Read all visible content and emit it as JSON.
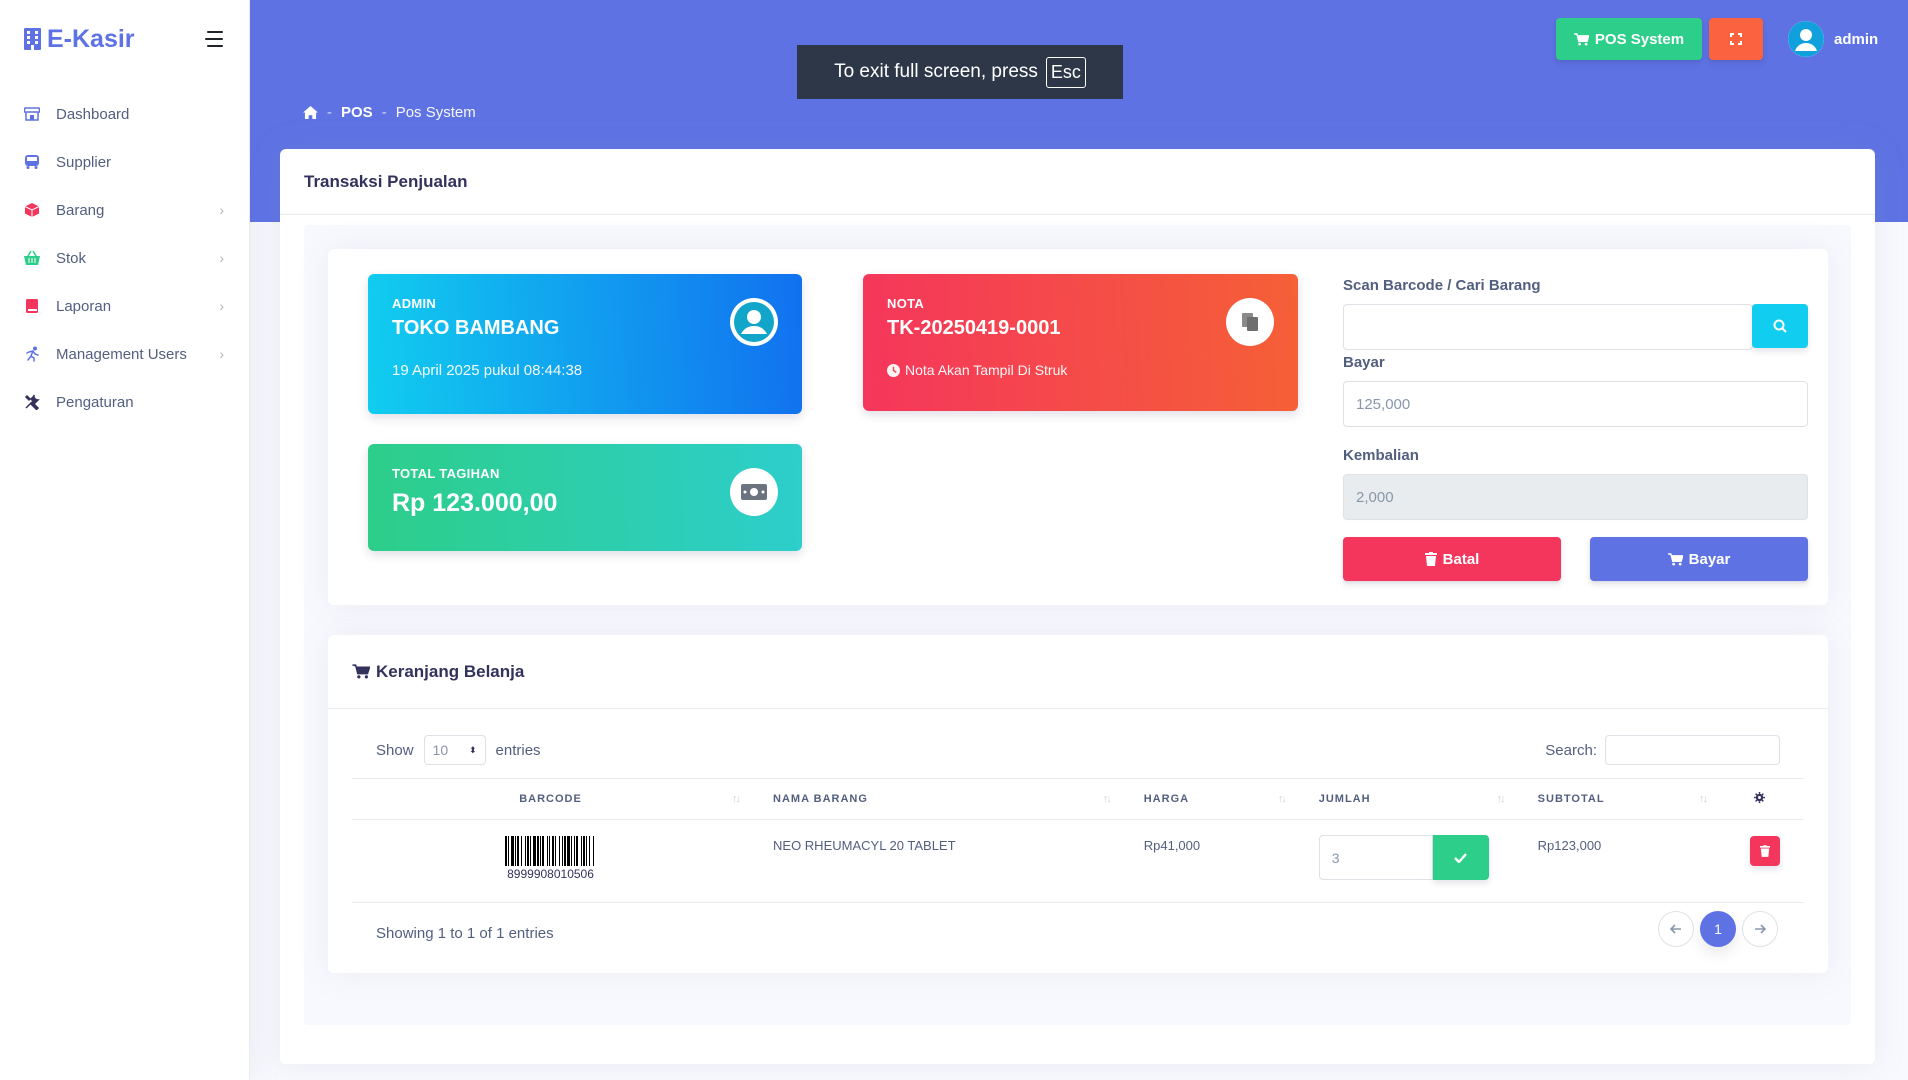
{
  "brand": {
    "name": "E-Kasir"
  },
  "sidebar": {
    "items": [
      {
        "label": "Dashboard",
        "icon": "store-icon",
        "has_children": false
      },
      {
        "label": "Supplier",
        "icon": "bus-icon",
        "has_children": false
      },
      {
        "label": "Barang",
        "icon": "box-icon",
        "has_children": true
      },
      {
        "label": "Stok",
        "icon": "basket-icon",
        "has_children": true
      },
      {
        "label": "Laporan",
        "icon": "book-icon",
        "has_children": true
      },
      {
        "label": "Management Users",
        "icon": "user-run-icon",
        "has_children": true
      },
      {
        "label": "Pengaturan",
        "icon": "tools-icon",
        "has_children": false
      }
    ]
  },
  "header": {
    "pos_button": "POS System",
    "username": "admin",
    "breadcrumb": [
      "POS",
      "Pos System"
    ]
  },
  "fullscreen_notice": {
    "text": "To exit full screen, press",
    "key": "Esc"
  },
  "page": {
    "title": "Transaksi Penjualan"
  },
  "cards": {
    "admin": {
      "label": "ADMIN",
      "value": "TOKO BAMBANG",
      "sub": "19 April 2025 pukul 08:44:38"
    },
    "nota": {
      "label": "NOTA",
      "value": "TK-20250419-0001",
      "sub": "Nota Akan Tampil Di Struk"
    },
    "total": {
      "label": "TOTAL TAGIHAN",
      "value": "Rp 123.000,00"
    }
  },
  "form": {
    "scan_label": "Scan Barcode / Cari Barang",
    "scan_value": "",
    "bayar_label": "Bayar",
    "bayar_value": "125,000",
    "kembalian_label": "Kembalian",
    "kembalian_value": "2,000",
    "batal_button": "Batal",
    "bayar_button": "Bayar"
  },
  "cart": {
    "title": "Keranjang Belanja",
    "show_label": "Show",
    "entries_value": "10",
    "entries_label": "entries",
    "search_label": "Search:",
    "columns": [
      "BARCODE",
      "NAMA BARANG",
      "HARGA",
      "JUMLAH",
      "SUBTOTAL"
    ],
    "rows": [
      {
        "barcode": "8999908010506",
        "nama": "NEO RHEUMACYL 20 TABLET",
        "harga": "Rp41,000",
        "jumlah": "3",
        "subtotal": "Rp123,000"
      }
    ],
    "info": "Showing 1 to 1 of 1 entries",
    "page": "1"
  },
  "colors": {
    "primary": "#5e72e4",
    "success": "#2dce89",
    "danger": "#f5365c",
    "warning": "#fb6340",
    "info": "#11cdef"
  }
}
